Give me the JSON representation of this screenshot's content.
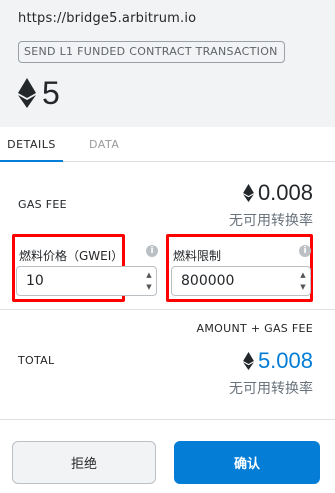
{
  "header": {
    "origin": "https://bridge5.arbitrum.io",
    "tx_type": "SEND L1 FUNDED CONTRACT TRANSACTION",
    "amount": "5",
    "currency_icon": "ethereum-icon"
  },
  "tabs": [
    {
      "label": "DETAILS",
      "active": true
    },
    {
      "label": "DATA",
      "active": false
    }
  ],
  "gas": {
    "label": "GAS FEE",
    "value": "0.008",
    "fiat": "无可用转换率"
  },
  "fields": {
    "gas_price": {
      "label": "燃料价格（GWEI）",
      "value": "10"
    },
    "gas_limit": {
      "label": "燃料限制",
      "value": "800000"
    },
    "info_symbol": "i"
  },
  "totals": {
    "sum_label": "AMOUNT + GAS FEE",
    "total_label": "TOTAL",
    "total_value": "5.008",
    "total_fiat": "无可用转换率"
  },
  "buttons": {
    "reject": "拒绝",
    "confirm": "确认"
  },
  "colors": {
    "accent": "#037dd6",
    "highlight": "#ff0000",
    "header_bg": "#f2f3f4"
  }
}
